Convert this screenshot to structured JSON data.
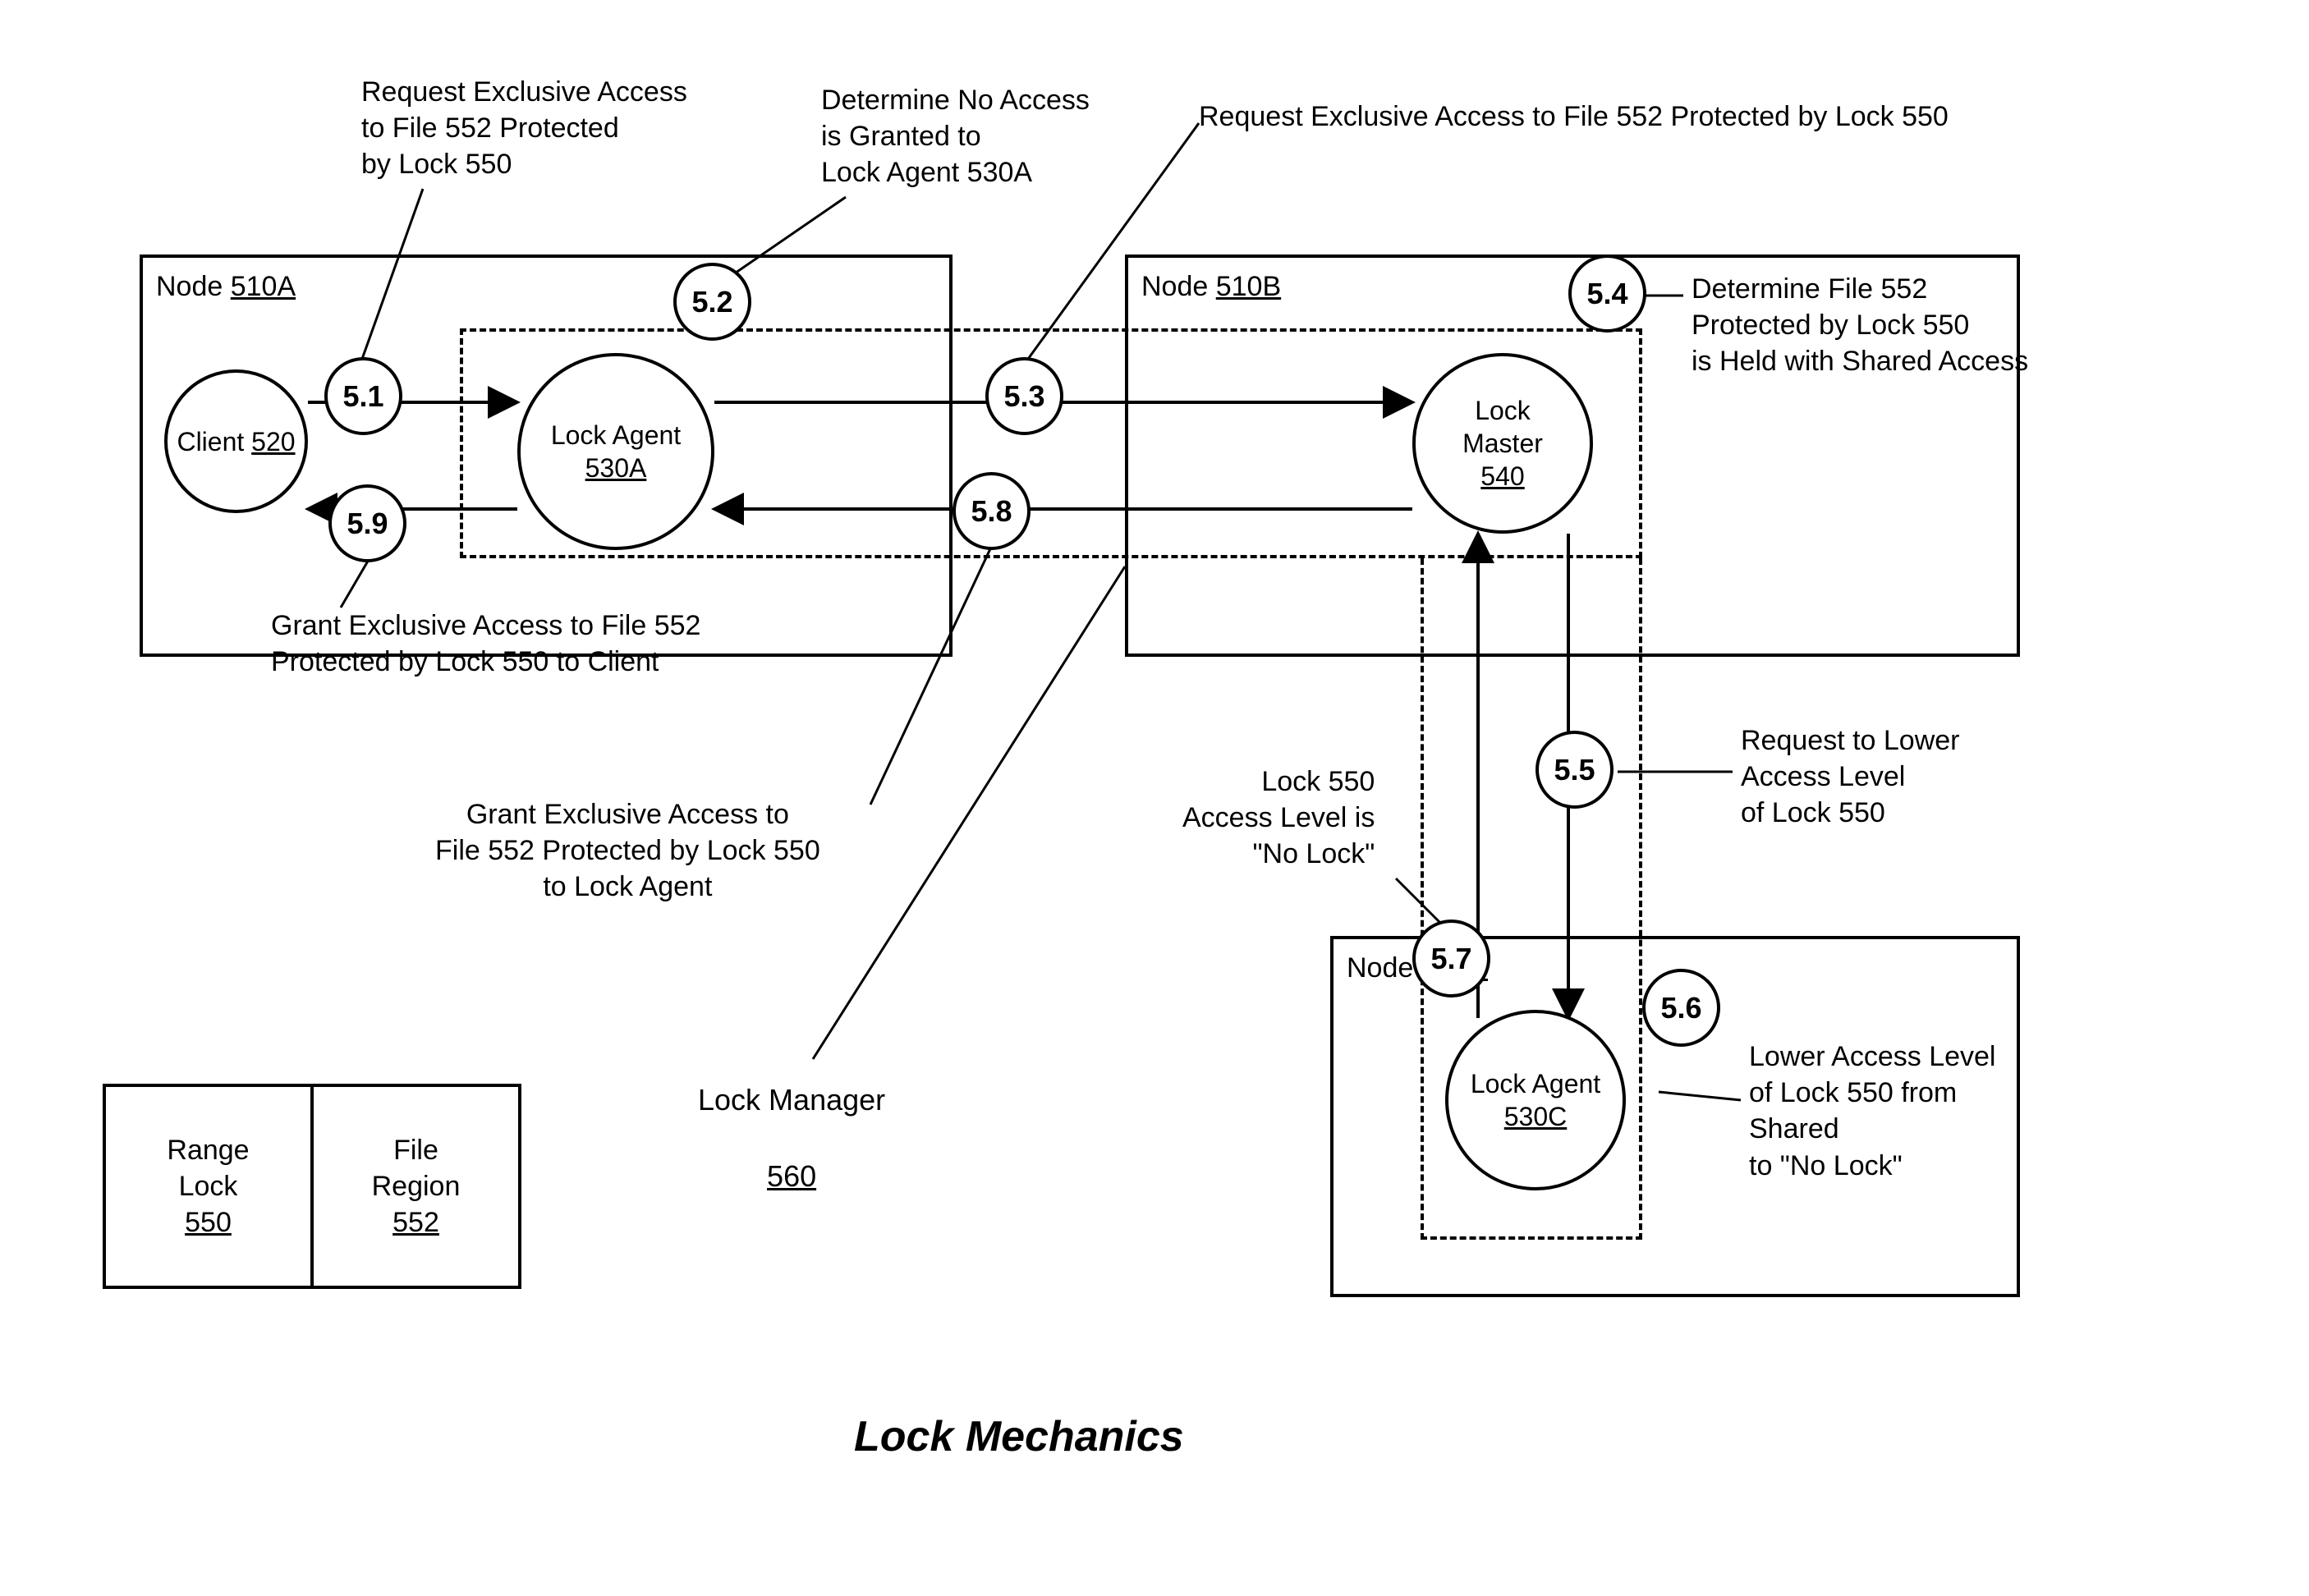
{
  "title": "Lock Mechanics",
  "nodes": {
    "a": {
      "prefix": "Node ",
      "id": "510A"
    },
    "b": {
      "prefix": "Node ",
      "id": "510B"
    },
    "c": {
      "prefix": "Node ",
      "id": "510C"
    }
  },
  "entities": {
    "client": {
      "line1": "Client ",
      "id": "520"
    },
    "lock_agent_a": {
      "line1": "Lock Agent",
      "id": "530A"
    },
    "lock_master": {
      "line1": "Lock",
      "line2": "Master",
      "id": "540"
    },
    "lock_agent_c": {
      "line1": "Lock Agent",
      "id": "530C"
    },
    "lock_manager": {
      "line1": "Lock Manager",
      "id": "560"
    }
  },
  "legend": {
    "range_lock": {
      "line1": "Range",
      "line2": "Lock",
      "id": "550"
    },
    "file_region": {
      "line1": "File",
      "line2": "Region",
      "id": "552"
    }
  },
  "steps": {
    "s51": "5.1",
    "s52": "5.2",
    "s53": "5.3",
    "s54": "5.4",
    "s55": "5.5",
    "s56": "5.6",
    "s57": "5.7",
    "s58": "5.8",
    "s59": "5.9"
  },
  "annotations": {
    "a51": "Request Exclusive Access\nto File 552 Protected\nby Lock 550",
    "a52": "Determine No Access\nis Granted to\nLock Agent 530A",
    "a53": "Request Exclusive Access to File 552 Protected by Lock 550",
    "a54": "Determine File 552\nProtected by Lock 550\nis Held with Shared Access",
    "a55": "Request to Lower\nAccess Level\nof Lock 550",
    "a56": "Lower Access Level\nof Lock 550 from\nShared\nto \"No Lock\"",
    "a57": "Lock 550\nAccess Level is\n\"No Lock\"",
    "a58": "Grant Exclusive Access to\nFile 552 Protected by Lock 550\nto Lock Agent",
    "a59": "Grant Exclusive Access to File 552\nProtected by Lock 550 to Client"
  }
}
